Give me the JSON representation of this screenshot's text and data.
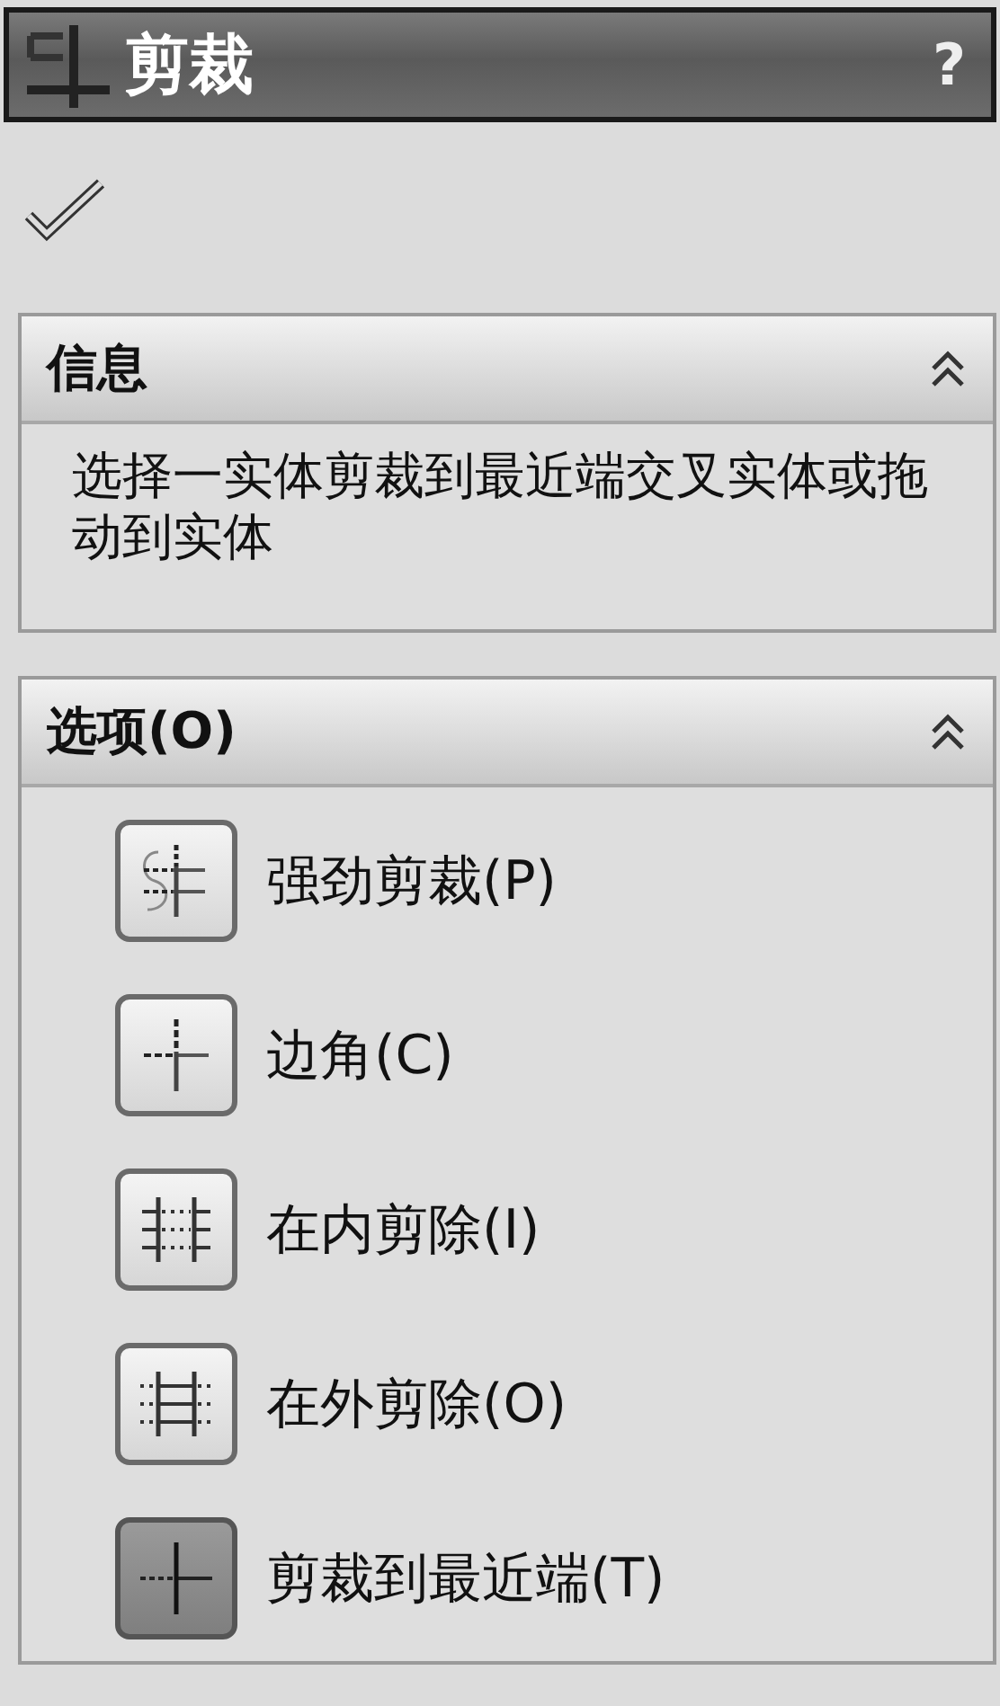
{
  "window": {
    "title": "剪裁",
    "help": "?"
  },
  "info": {
    "title": "信息",
    "expanded": true,
    "text": "选择一实体剪裁到最近端交叉实体或拖动到实体"
  },
  "options": {
    "title": "选项(O)",
    "expanded": true,
    "items": [
      {
        "kind": "power",
        "label": "强劲剪裁(P)",
        "selected": false
      },
      {
        "kind": "corner",
        "label": "边角(C)",
        "selected": false
      },
      {
        "kind": "inside",
        "label": "在内剪除(I)",
        "selected": false
      },
      {
        "kind": "outside",
        "label": "在外剪除(O)",
        "selected": false
      },
      {
        "kind": "nearest",
        "label": "剪裁到最近端(T)",
        "selected": true
      }
    ]
  }
}
